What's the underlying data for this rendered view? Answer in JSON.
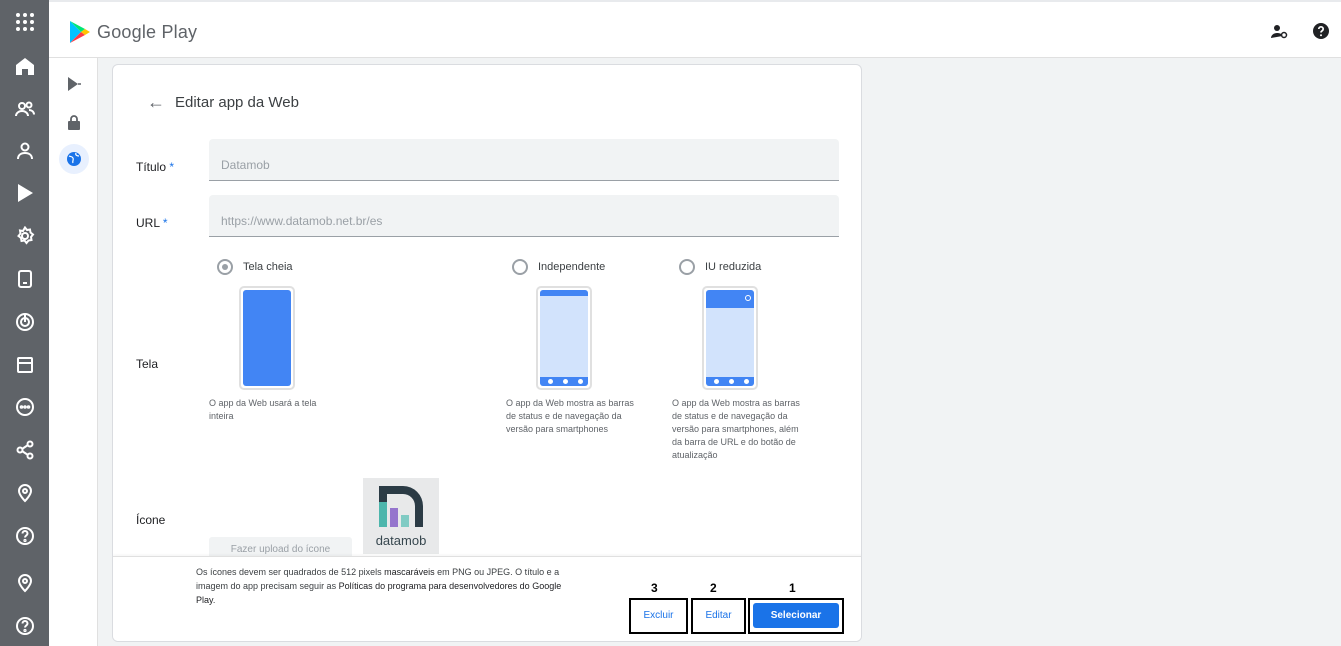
{
  "header": {
    "brand": "Google Play"
  },
  "card": {
    "title": "Editar app da Web",
    "title_label": "Título",
    "title_value": "Datamob",
    "url_label": "URL",
    "url_value": "https://www.datamob.net.br/es",
    "required_mark": "*",
    "screen_label": "Tela",
    "icon_label": "Ícone",
    "screen_options": [
      {
        "label": "Tela cheia",
        "selected": true,
        "description": "O app da Web usará a tela inteira"
      },
      {
        "label": "Independente",
        "selected": false,
        "description": "O app da Web mostra as barras de status e de navegação da versão para smartphones"
      },
      {
        "label": "IU reduzida",
        "selected": false,
        "description": "O app da Web mostra as barras de status e de navegação da versão para smartphones, além da barra de URL e do botão de atualização"
      }
    ],
    "upload_button": "Fazer upload do ícone",
    "icon_logo_text": "datamob"
  },
  "footer": {
    "note_part1": "Os ícones devem ser quadrados de 512 pixels ",
    "note_link1": "mascaráveis",
    "note_part2": " em PNG ou JPEG. O título e a imagem do app precisam seguir as ",
    "note_link2": "Políticas do programa para desenvolvedores do Google Play",
    "note_part3": ".",
    "buttons": [
      {
        "number": "3",
        "label": "Excluir"
      },
      {
        "number": "2",
        "label": "Editar"
      },
      {
        "number": "1",
        "label": "Selecionar"
      }
    ]
  },
  "colors": {
    "accent": "#1a73e8",
    "rail": "#5f6368",
    "phone_blue": "#4285f4",
    "phone_light": "#d2e3fc"
  }
}
